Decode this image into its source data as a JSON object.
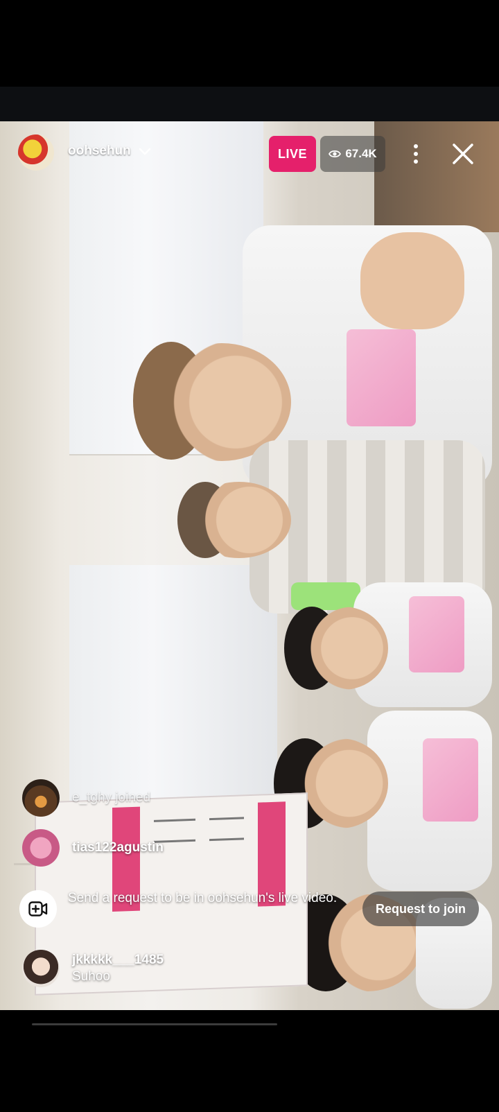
{
  "header": {
    "username": "oohsehun",
    "live_label": "LIVE",
    "viewer_count": "67.4K"
  },
  "comments": [
    {
      "username": "e_tghy",
      "message": "joined",
      "type": "joined"
    },
    {
      "username": "tias122agustin",
      "message": "",
      "type": "comment"
    },
    {
      "username": "jkkkkk___1485",
      "message": "Suhoo",
      "type": "comment"
    }
  ],
  "join_request": {
    "text": "Send a request to be in oohsehun's live video.",
    "button_label": "Request to join"
  },
  "colors": {
    "live_badge": "#e5206b",
    "viewer_pill": "#3c3c3c"
  },
  "icons": [
    "chevron-down-icon",
    "eye-icon",
    "more-vertical-icon",
    "close-icon",
    "video-add-icon"
  ]
}
